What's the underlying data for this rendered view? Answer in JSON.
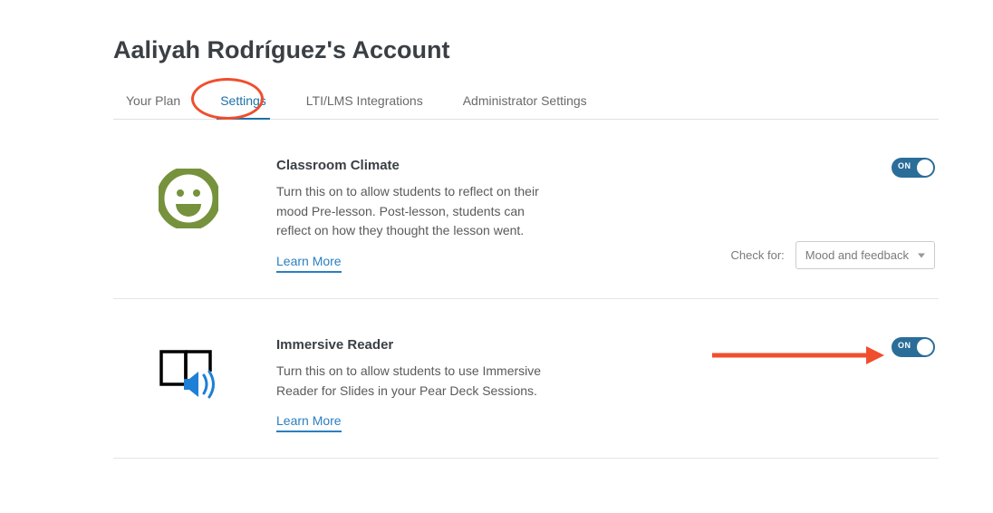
{
  "pageTitle": "Aaliyah Rodríguez's Account",
  "tabs": {
    "items": [
      {
        "label": "Your Plan",
        "active": false
      },
      {
        "label": "Settings",
        "active": true
      },
      {
        "label": "LTI/LMS Integrations",
        "active": false
      },
      {
        "label": "Administrator Settings",
        "active": false
      }
    ]
  },
  "settings": {
    "classroomClimate": {
      "title": "Classroom Climate",
      "description": "Turn this on to allow students to reflect on their mood Pre-lesson. Post-lesson, students can reflect on how they thought the lesson went.",
      "learnMore": "Learn More",
      "toggle": {
        "on": true,
        "label": "ON"
      },
      "checkForLabel": "Check for:",
      "checkForValue": "Mood and feedback"
    },
    "immersiveReader": {
      "title": "Immersive Reader",
      "description": "Turn this on to allow students to use Immersive Reader for Slides in your Pear Deck Sessions.",
      "learnMore": "Learn More",
      "toggle": {
        "on": true,
        "label": "ON"
      }
    }
  },
  "annotations": {
    "circledTab": "Settings",
    "arrowTarget": "Immersive Reader toggle"
  }
}
